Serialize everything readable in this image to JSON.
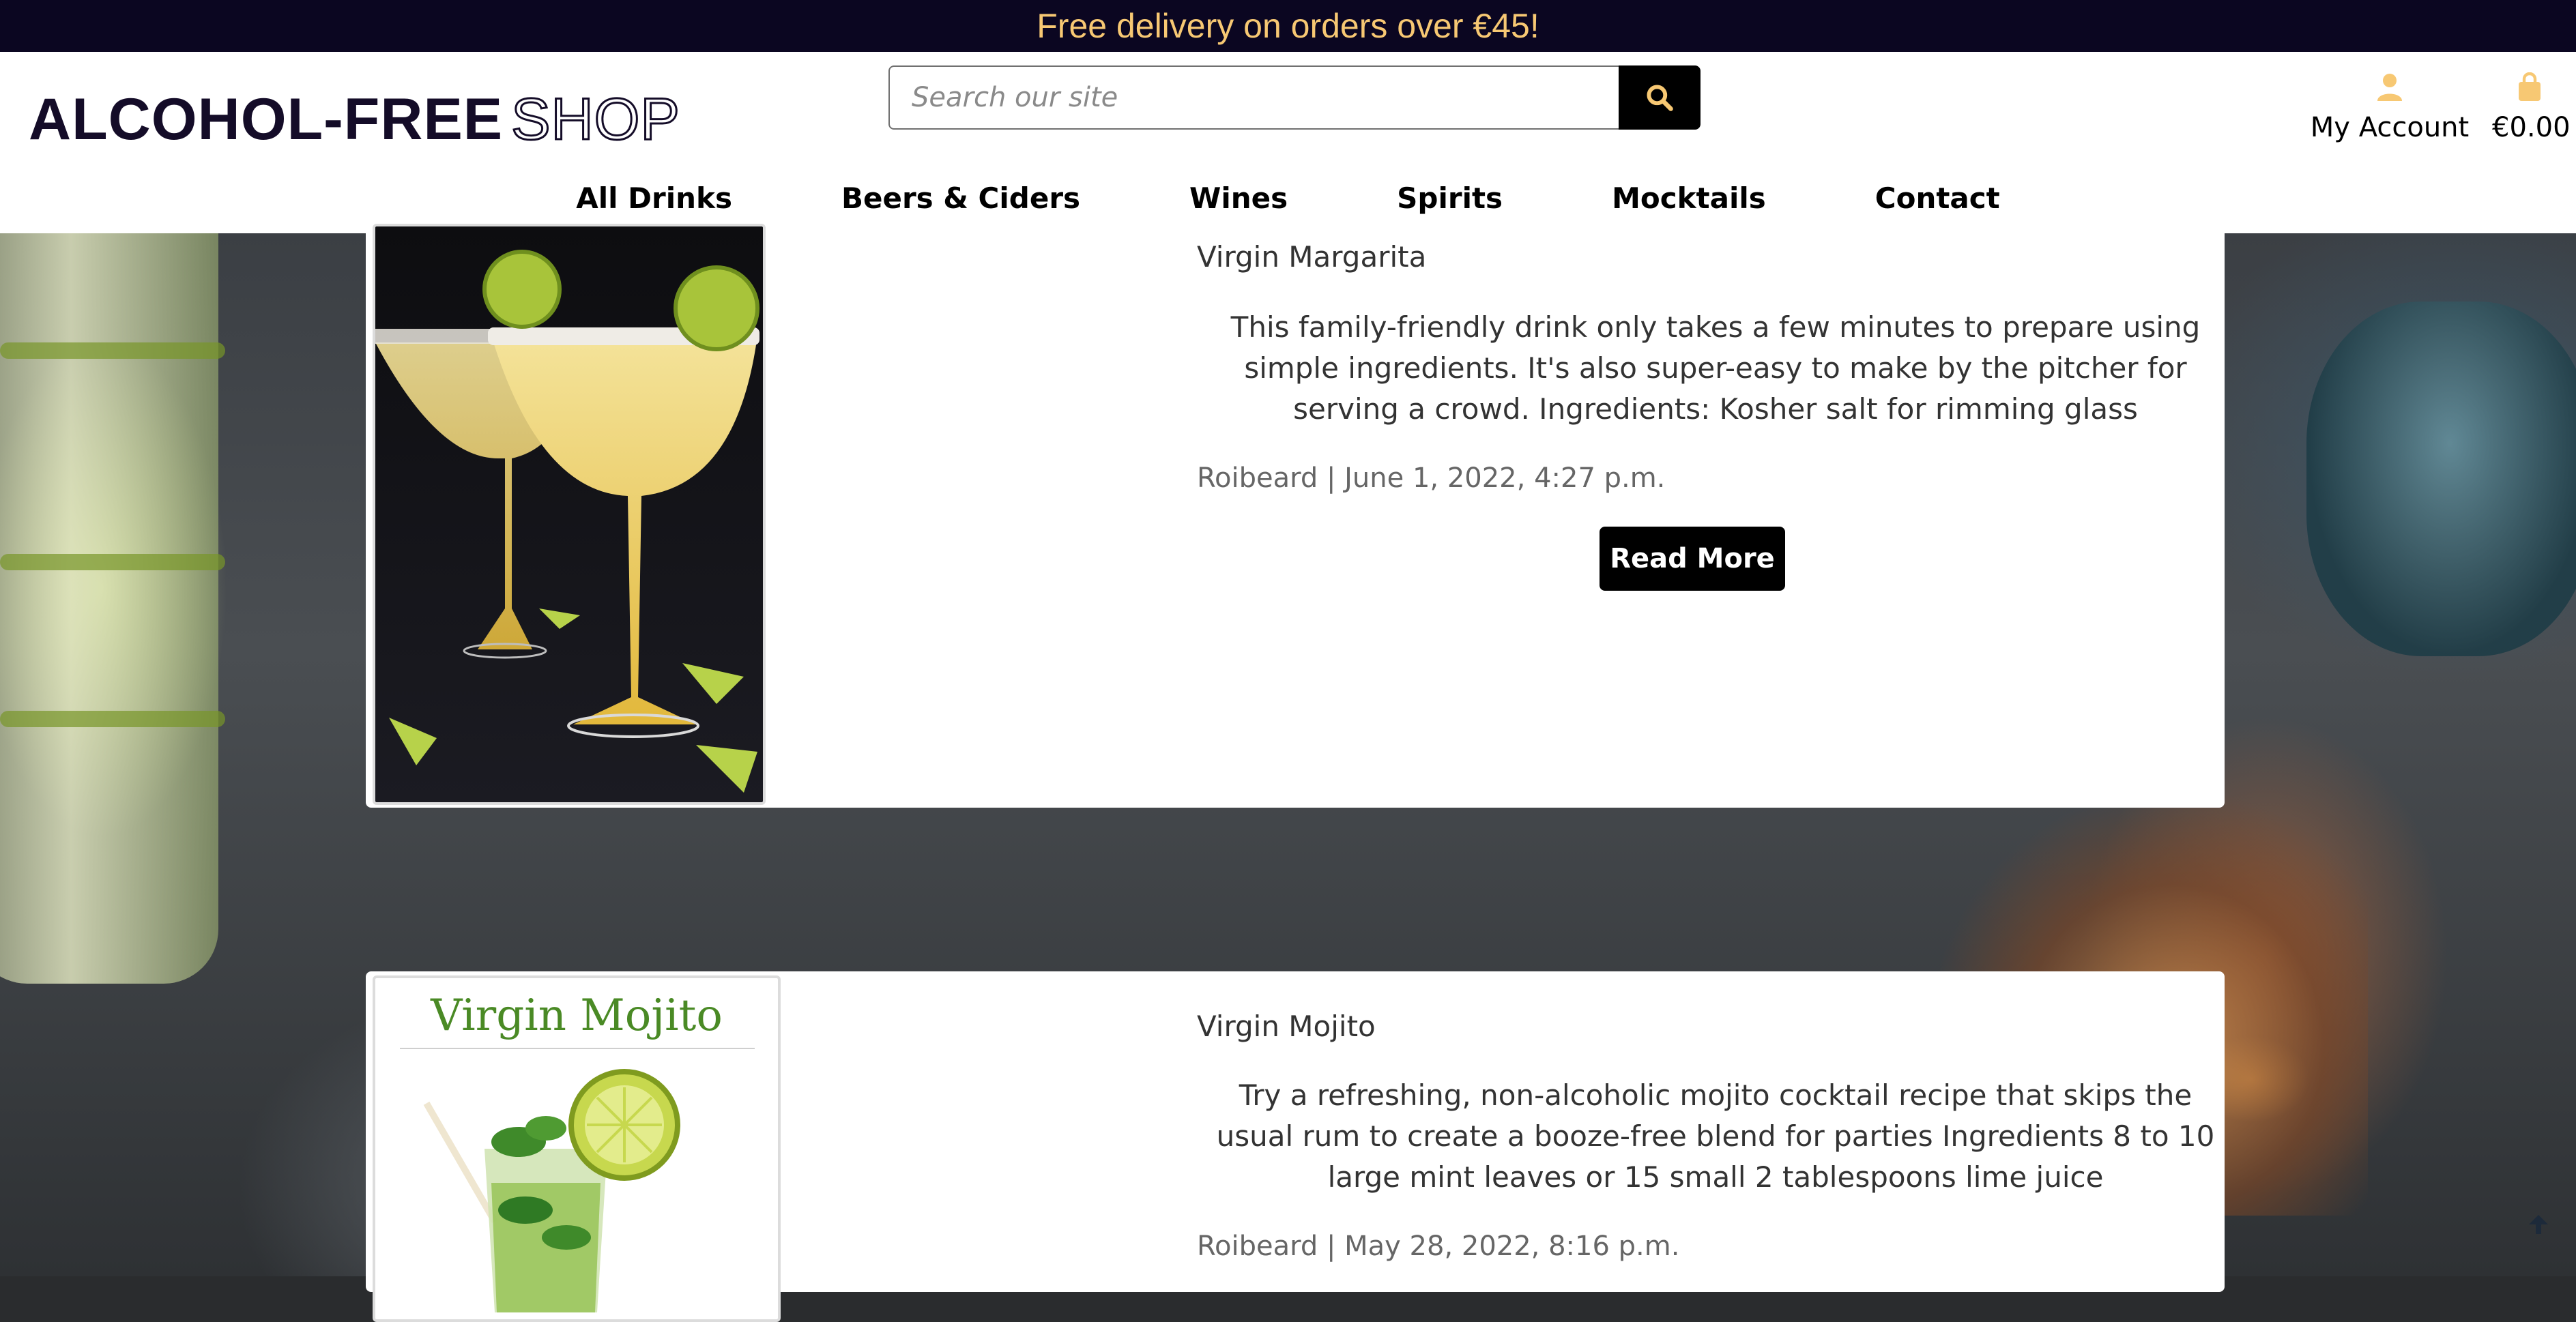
{
  "promo": {
    "text": "Free delivery on orders over €45!"
  },
  "header": {
    "logo_bold": "ALCOHOL-FREE",
    "logo_outline": "SHOP",
    "search": {
      "placeholder": "Search our site",
      "button_icon": "search-icon"
    },
    "account_label": "My Account",
    "cart_total": "€0.00",
    "accent_color": "#f7c873"
  },
  "nav": {
    "items": [
      {
        "label": "All Drinks"
      },
      {
        "label": "Beers & Ciders"
      },
      {
        "label": "Wines"
      },
      {
        "label": "Spirits"
      },
      {
        "label": "Mocktails"
      },
      {
        "label": "Contact"
      }
    ]
  },
  "posts": [
    {
      "title": "Virgin Margarita",
      "excerpt": "This family-friendly drink only takes a few minutes to prepare using simple ingredients. It's also super-easy to make by the pitcher for serving a crowd. Ingredients: Kosher salt for rimming glass",
      "meta": "Roibeard | June 1, 2022, 4:27 p.m.",
      "button": "Read More"
    },
    {
      "title": "Virgin Mojito",
      "image_title": "Virgin Mojito",
      "excerpt": "Try a refreshing, non-alcoholic mojito cocktail recipe that skips the usual rum to create a booze-free blend for parties Ingredients 8 to 10 large mint leaves or 15 small 2 tablespoons lime juice",
      "meta": "Roibeard | May 28, 2022, 8:16 p.m."
    }
  ]
}
